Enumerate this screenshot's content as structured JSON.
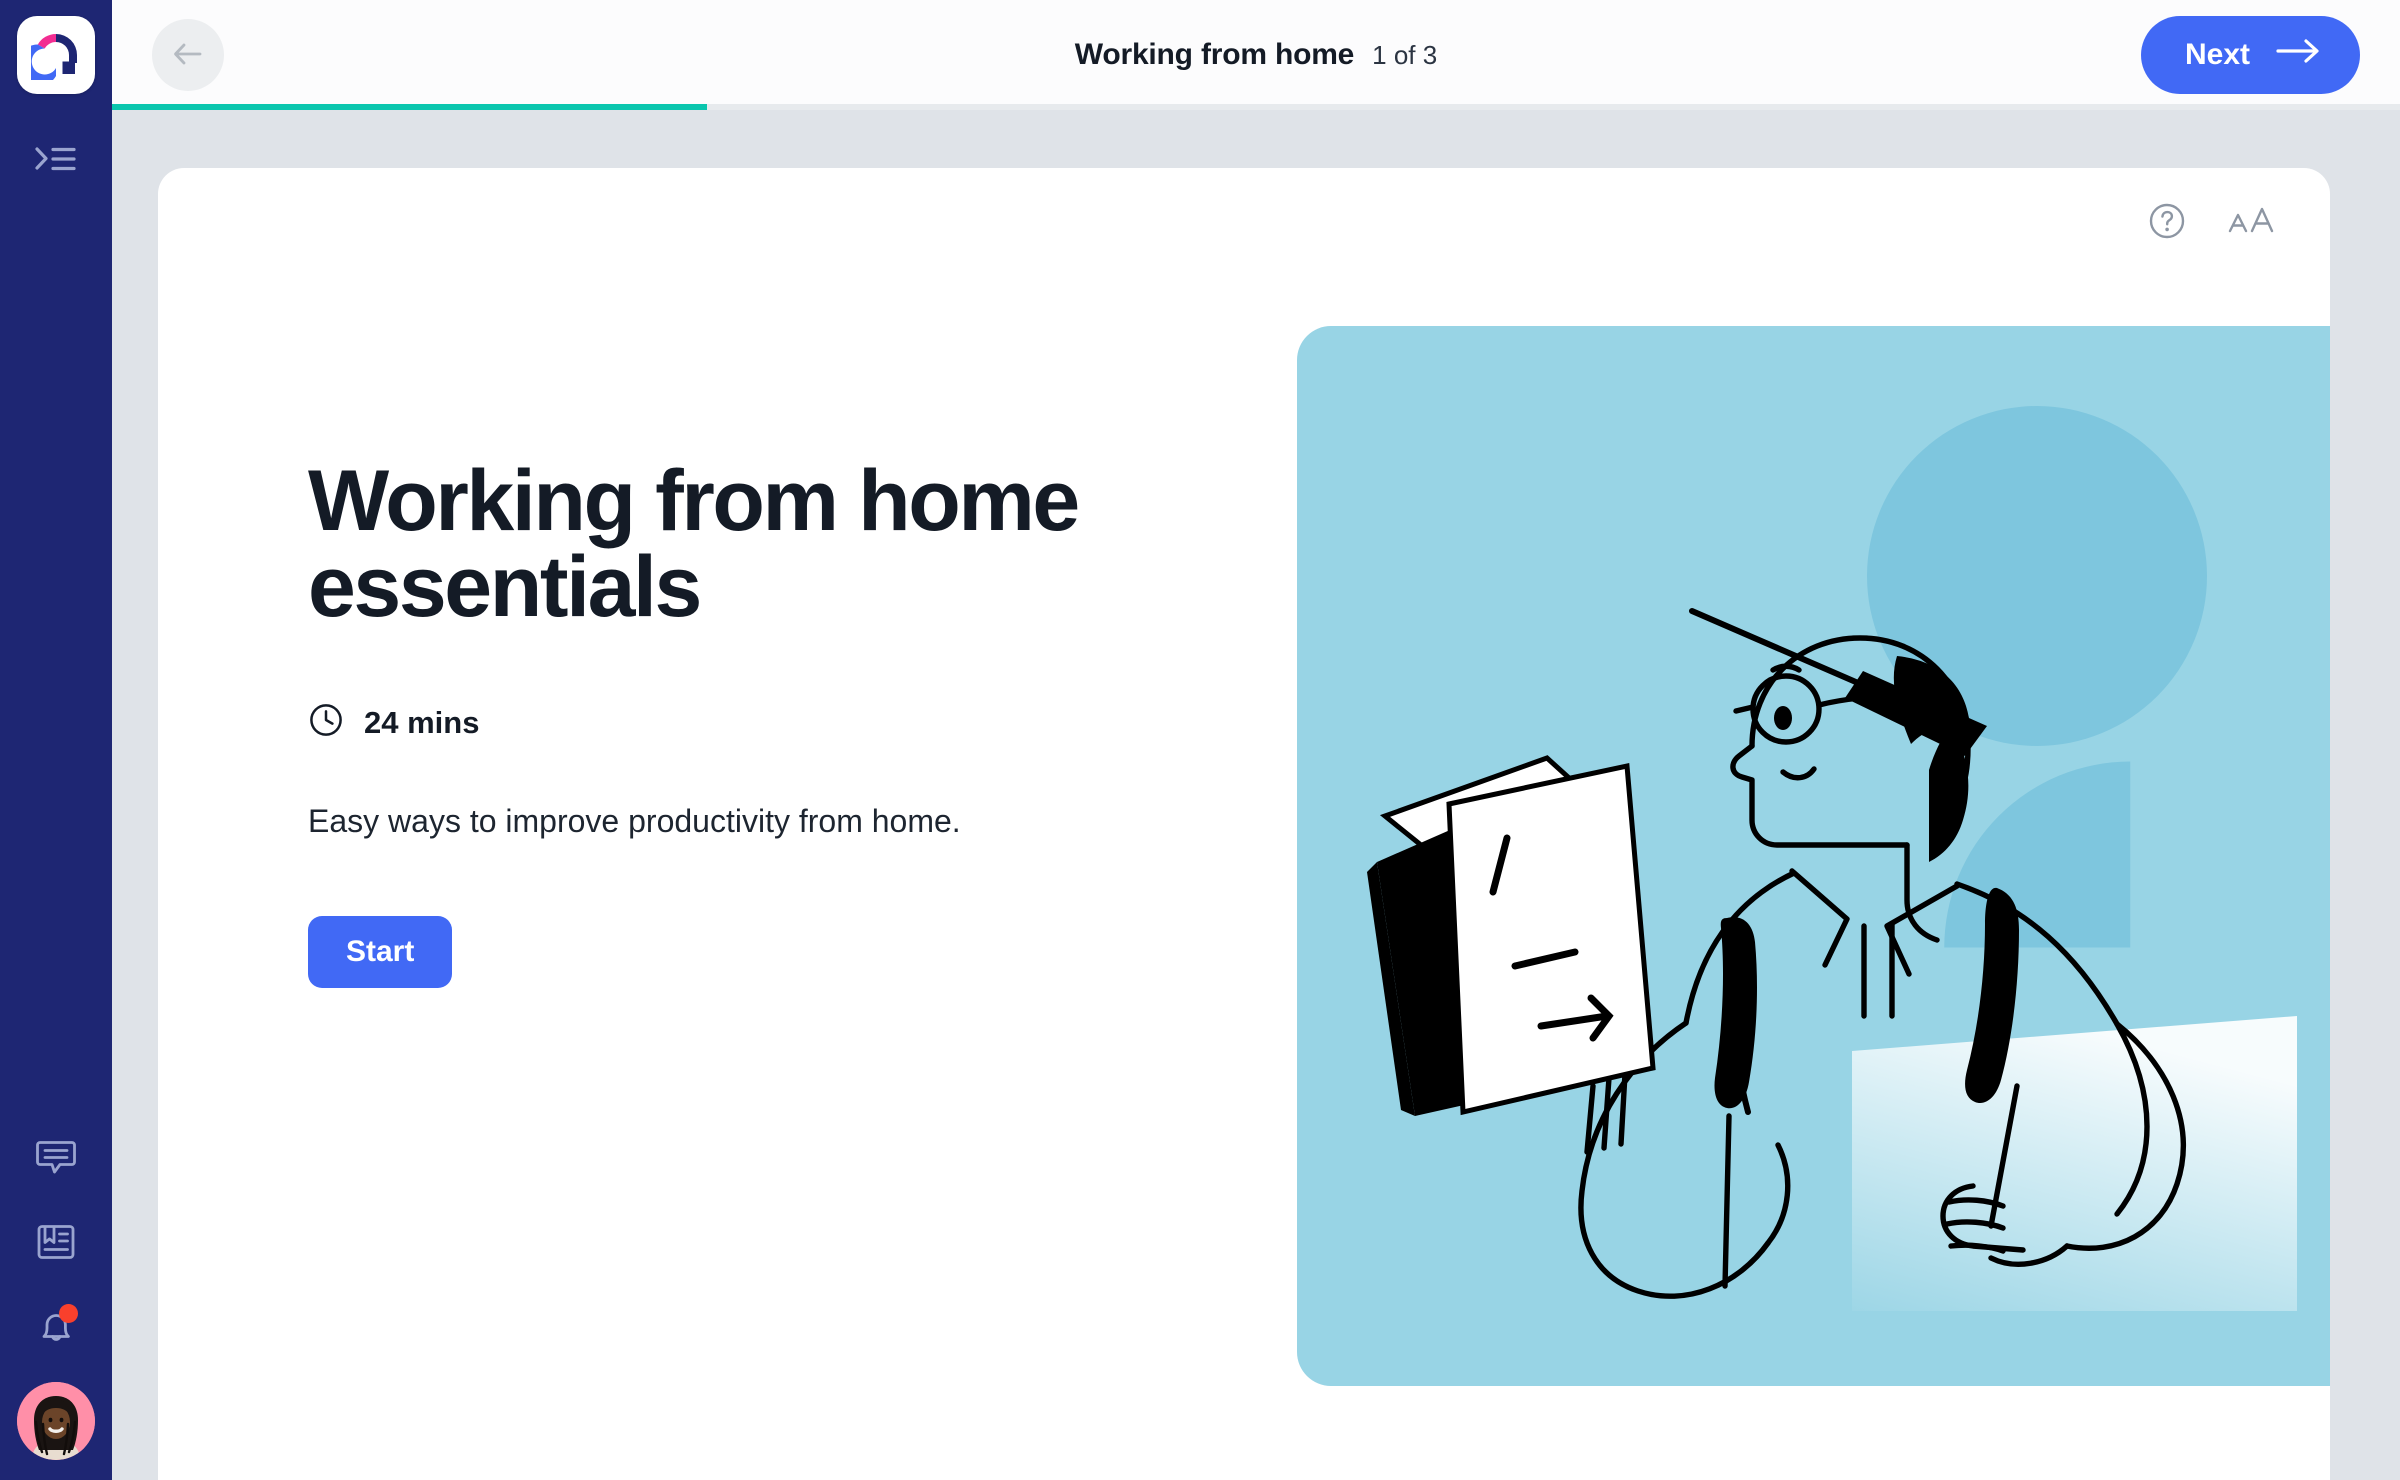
{
  "brand": {
    "logo_name": "company-logo",
    "colors": {
      "navy": "#1e2673",
      "pink": "#f22d92",
      "blue": "#4169f5",
      "accent_progress": "#0ac6ae",
      "illustration_bg": "#98d4e5",
      "illustration_shape": "#7ec6de",
      "avatar_bg": "#ff8fa8",
      "notification": "#f9402c"
    }
  },
  "sidebar": {
    "menu_toggle_label": "Expand menu",
    "items": [
      {
        "id": "chat",
        "icon": "chat-bubble-icon",
        "label": "Chat"
      },
      {
        "id": "library",
        "icon": "book-library-icon",
        "label": "Library"
      },
      {
        "id": "notifications",
        "icon": "bell-icon",
        "label": "Notifications",
        "has_badge": true
      }
    ],
    "avatar_label": "User profile"
  },
  "header": {
    "back_label": "Back",
    "title": "Working from home",
    "count": "1 of 3",
    "next_label": "Next",
    "progress_percent": 26
  },
  "card": {
    "tools": [
      {
        "id": "help",
        "icon": "help-circle-icon",
        "label": "Help"
      },
      {
        "id": "font-size",
        "icon": "text-size-icon",
        "label": "AA"
      }
    ]
  },
  "lesson": {
    "title": "Working from home essentials",
    "duration_icon": "clock-icon",
    "duration": "24 mins",
    "description": "Easy ways to improve productivity from home.",
    "start_label": "Start"
  },
  "illustration": {
    "name": "person-reading-book-illustration",
    "alt": "Illustration of a person wearing glasses and a backpack reading an open book"
  }
}
